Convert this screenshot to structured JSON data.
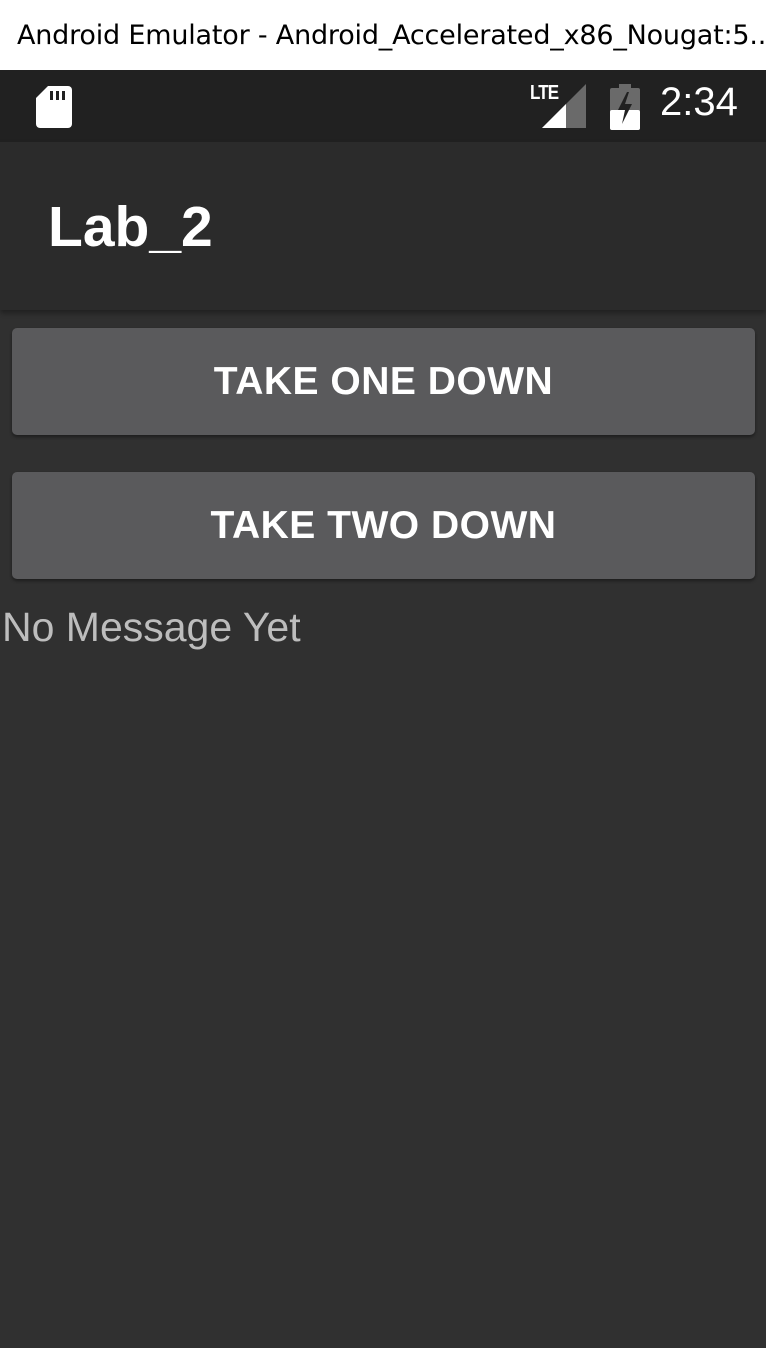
{
  "window": {
    "title": "Android Emulator - Android_Accelerated_x86_Nougat:5..."
  },
  "status_bar": {
    "network_label": "LTE",
    "time": "2:34",
    "icons": [
      "sd-card-icon",
      "lte-signal-icon",
      "battery-charging-icon"
    ]
  },
  "app_bar": {
    "title": "Lab_2"
  },
  "buttons": {
    "take_one": "TAKE ONE DOWN",
    "take_two": "TAKE TWO DOWN"
  },
  "message": {
    "text": "No Message Yet"
  },
  "colors": {
    "background": "#303030",
    "status_bar": "#212121",
    "app_bar": "#2b2b2b",
    "button": "#5a5a5c",
    "message_text": "#bdbdbd"
  }
}
